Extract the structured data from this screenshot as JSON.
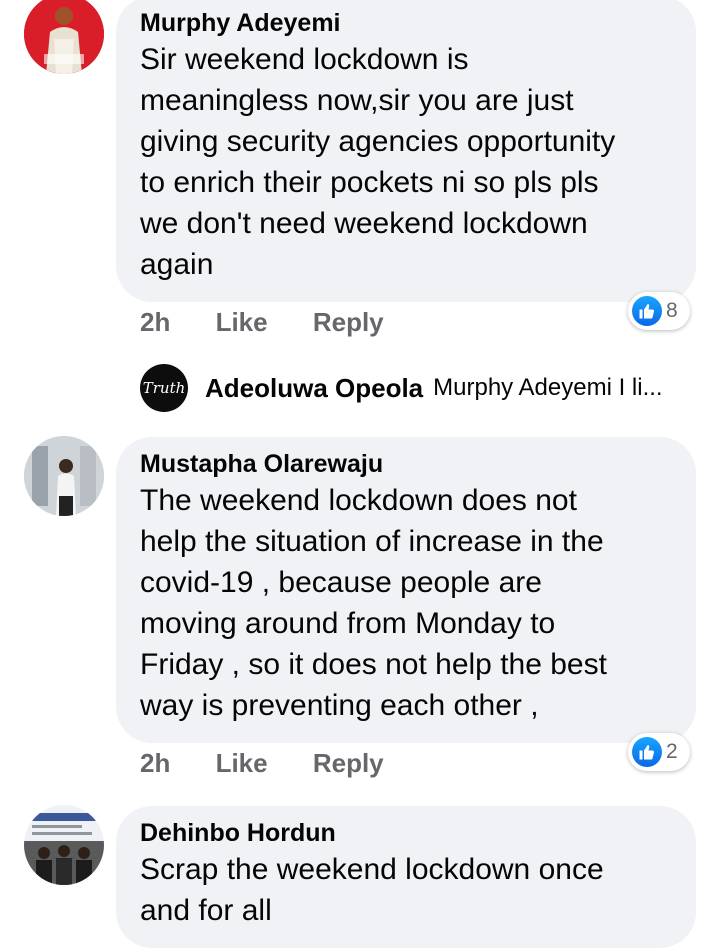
{
  "comments": [
    {
      "author": "Murphy Adeyemi",
      "text_lines": [
        "Sir weekend lockdown is",
        "meaningless now,sir you are just",
        "giving security agencies opportunity",
        "to enrich their pockets ni so pls pls",
        "we don't need weekend lockdown",
        "again"
      ],
      "time": "2h",
      "like_label": "Like",
      "reply_label": "Reply",
      "reaction_count": "8"
    },
    {
      "author": "Mustapha Olarewaju",
      "text_lines": [
        "The weekend lockdown does not",
        "help the situation of increase in the",
        "covid-19 , because people are",
        "moving around from Monday to",
        "Friday , so it does not help the best",
        "way is preventing each other ,"
      ],
      "time": "2h",
      "like_label": "Like",
      "reply_label": "Reply",
      "reaction_count": "2"
    },
    {
      "author": "Dehinbo Hordun",
      "text_lines": [
        "Scrap the weekend lockdown once",
        "and for all"
      ]
    }
  ],
  "reply_preview": {
    "avatar_text": "Truth",
    "author": "Adeoluwa Opeola",
    "text": "Murphy Adeyemi  I li..."
  },
  "colors": {
    "bubble": "#f0f2f5",
    "meta": "#65676b",
    "like_blue": "#1877f2"
  },
  "icons": [
    "like-icon"
  ]
}
